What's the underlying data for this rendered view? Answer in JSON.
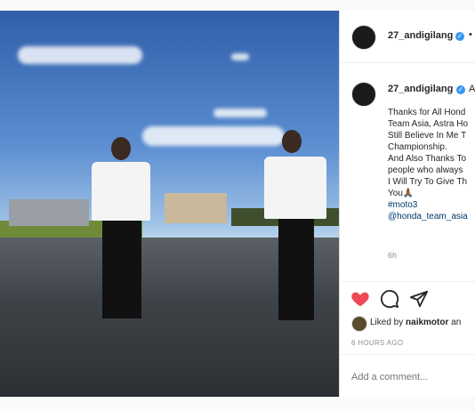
{
  "post": {
    "username": "27_andigilang",
    "header_more": "•",
    "caption_user": "27_andigilang",
    "caption_user_suffix": "A",
    "caption_lines": [
      "Thanks for All Hond",
      "Team Asia, Astra Ho",
      "Still Believe In Me T",
      "Championship.",
      "And Also Thanks To",
      "people who always",
      "I Will Try To Give Th",
      "You🙏🏾"
    ],
    "hashtag": "#moto3",
    "mention": "@honda_team_asia",
    "post_time": "6h",
    "liked_by_prefix": "Liked by",
    "liked_by_user": "naikmotor",
    "liked_by_suffix": "an",
    "timestamp": "6 HOURS AGO",
    "comment_placeholder": "Add a comment..."
  },
  "colors": {
    "like_red": "#ed4956",
    "verified_blue": "#3897f0",
    "link_blue": "#00376b"
  },
  "icons": [
    "heart-icon",
    "comment-icon",
    "share-icon",
    "verified-badge-icon"
  ]
}
